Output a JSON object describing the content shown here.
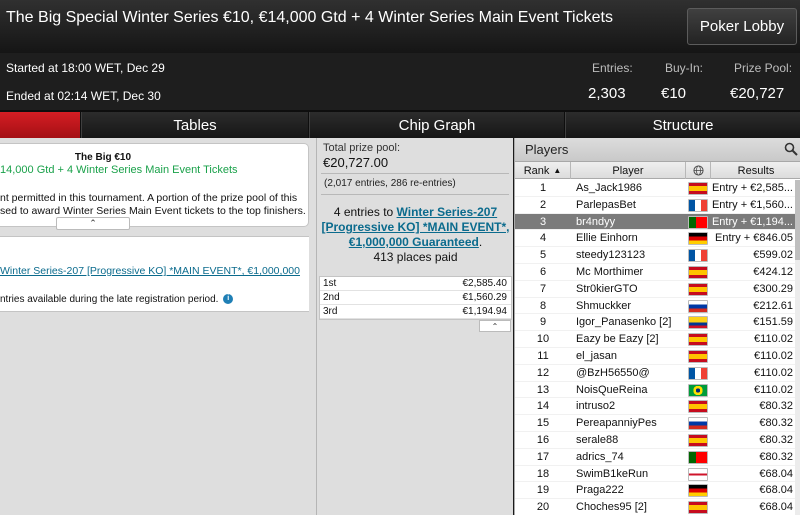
{
  "header": {
    "title": "The Big Special Winter Series €10, €14,000 Gtd + 4 Winter Series Main Event Tickets",
    "lobby_button": "Poker Lobby"
  },
  "info": {
    "started": "Started at 18:00 WET, Dec 29",
    "ended": "Ended at 02:14 WET, Dec 30",
    "entries_label": "Entries:",
    "entries_value": "2,303",
    "buyin_label": "Buy-In:",
    "buyin_value": "€10",
    "prizepool_label": "Prize Pool:",
    "prizepool_value": "€20,727"
  },
  "tabs": [
    {
      "label": ""
    },
    {
      "label": "Tables"
    },
    {
      "label": "Chip Graph"
    },
    {
      "label": "Structure"
    }
  ],
  "left": {
    "card_name": "The Big €10",
    "card_sub": "14,000 Gtd + 4 Winter Series Main Event Tickets",
    "card_desc_1": "nt permitted in this tournament. A portion of the prize pool of this",
    "card_desc_2": "sed to award Winter Series Main Event tickets to the top finishers.",
    "link": "Winter Series-207 [Progressive KO] *MAIN EVENT*, €1,000,000",
    "note": "ntries available during the late registration period."
  },
  "middle": {
    "prize_pool_label": "Total prize pool:",
    "prize_pool_value": "€20,727.00",
    "entries_text": "(2,017 entries, 286 re-entries)",
    "tickets_prefix": "4 entries to",
    "tickets_link": "Winter Series-207 [Progressive KO] *MAIN EVENT*, €1,000,000 Guaranteed",
    "tickets_suffix": ".",
    "places_paid": "413 places paid",
    "payouts": [
      {
        "pos": "1st",
        "amount": "€2,585.40"
      },
      {
        "pos": "2nd",
        "amount": "€1,560.29"
      },
      {
        "pos": "3rd",
        "amount": "€1,194.94"
      }
    ]
  },
  "players": {
    "title": "Players",
    "col_rank": "Rank",
    "col_player": "Player",
    "col_results": "Results",
    "rows": [
      {
        "rank": "1",
        "name": "As_Jack1986",
        "flag": "ES",
        "result": "Entry + €2,585..."
      },
      {
        "rank": "2",
        "name": "ParlepasBet",
        "flag": "FR",
        "result": "Entry + €1,560..."
      },
      {
        "rank": "3",
        "name": "br4ndyy",
        "flag": "PT",
        "result": "Entry + €1,194...",
        "selected": true
      },
      {
        "rank": "4",
        "name": "Ellie Einhorn",
        "flag": "DE",
        "result": "Entry + €846.05"
      },
      {
        "rank": "5",
        "name": "steedy123123",
        "flag": "FR",
        "result": "€599.02"
      },
      {
        "rank": "6",
        "name": "Mc Morthimer",
        "flag": "ES",
        "result": "€424.12"
      },
      {
        "rank": "7",
        "name": "Str0kierGTO",
        "flag": "ES",
        "result": "€300.29"
      },
      {
        "rank": "8",
        "name": "Shmuckker",
        "flag": "RU",
        "result": "€212.61"
      },
      {
        "rank": "9",
        "name": "Igor_Panasenko [2]",
        "flag": "CO",
        "result": "€151.59"
      },
      {
        "rank": "10",
        "name": "Eazy be Eazy [2]",
        "flag": "ES",
        "result": "€110.02"
      },
      {
        "rank": "11",
        "name": "el_jasan",
        "flag": "ES",
        "result": "€110.02"
      },
      {
        "rank": "12",
        "name": "@BzH56550@",
        "flag": "FR",
        "result": "€110.02"
      },
      {
        "rank": "13",
        "name": "NoisQueReina",
        "flag": "BR",
        "result": "€110.02"
      },
      {
        "rank": "14",
        "name": "intruso2",
        "flag": "ES",
        "result": "€80.32"
      },
      {
        "rank": "15",
        "name": "PereapanniyPes",
        "flag": "RU",
        "result": "€80.32"
      },
      {
        "rank": "16",
        "name": "serale88",
        "flag": "ES",
        "result": "€80.32"
      },
      {
        "rank": "17",
        "name": "adrics_74",
        "flag": "PT",
        "result": "€80.32"
      },
      {
        "rank": "18",
        "name": "SwimB1keRun",
        "flag": "GB",
        "result": "€68.04"
      },
      {
        "rank": "19",
        "name": "Praga222",
        "flag": "DE",
        "result": "€68.04"
      },
      {
        "rank": "20",
        "name": "Choches95 [2]",
        "flag": "ES",
        "result": "€68.04"
      }
    ]
  },
  "colors": {
    "accent_red": "#c8171d",
    "link": "#0b6b8d",
    "green": "#1aa14a"
  }
}
